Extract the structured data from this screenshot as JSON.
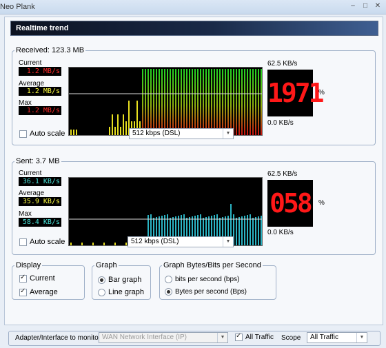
{
  "window": {
    "title": "Neo Plank",
    "min_icon": "minimize-icon",
    "max_icon": "maximize-icon",
    "close_icon": "close-icon"
  },
  "header": {
    "title": "Realtime trend"
  },
  "received": {
    "legend": "Received: 123.3 MB",
    "current_label": "Current",
    "current_value": "1.2 MB/s",
    "average_label": "Average",
    "average_value": "1.2 MB/s",
    "max_label": "Max",
    "max_value": "1.2 MB/s",
    "scale_top": "62.5 KB/s",
    "scale_bottom": "0.0 KB/s",
    "meter_value": "1971",
    "meter_unit": "%",
    "autoscale_label": "Auto scale",
    "autoscale_checked": false,
    "speed_select": "512 kbps  (DSL)",
    "value_color": "#ff2a2a",
    "avg_value_color": "#ffff40",
    "bar_style": "green-top-red-bottom"
  },
  "sent": {
    "legend": "Sent: 3.7 MB",
    "current_label": "Current",
    "current_value": "36.1 KB/s",
    "average_label": "Average",
    "average_value": "35.9 KB/s",
    "max_label": "Max",
    "max_value": "58.4 KB/s",
    "scale_top": "62.5 KB/s",
    "scale_bottom": "0.0 KB/s",
    "meter_value": "058",
    "meter_unit": "%",
    "autoscale_label": "Auto scale",
    "autoscale_checked": false,
    "speed_select": "512 kbps  (DSL)",
    "value_color": "#49e3d9",
    "avg_value_color": "#ffff40",
    "bar_style": "cyan"
  },
  "display": {
    "legend": "Display",
    "current_label": "Current",
    "current_checked": true,
    "average_label": "Average",
    "average_checked": true
  },
  "graph": {
    "legend": "Graph",
    "bar_label": "Bar graph",
    "line_label": "Line graph",
    "selected": "bar"
  },
  "units": {
    "legend": "Graph Bytes/Bits per Second",
    "bps_label": "bits per second (bps)",
    "Bps_label": "Bytes per second (Bps)",
    "selected": "Bps"
  },
  "bottom": {
    "adapter_label": "Adapter/Interface to monitor",
    "adapter_value": "WAN Network Interface (IP)",
    "alltraffic_label": "All Traffic",
    "alltraffic_checked": true,
    "scope_label": "Scope",
    "scope_value": "All Traffic"
  },
  "colors": {
    "accent": "#3f5f92",
    "recv_line": "#dcdcdc",
    "sent_bar": "#2bb4c4",
    "recv_green": "#22d422",
    "recv_red": "#cc1010",
    "yellow": "#e8e020"
  }
}
